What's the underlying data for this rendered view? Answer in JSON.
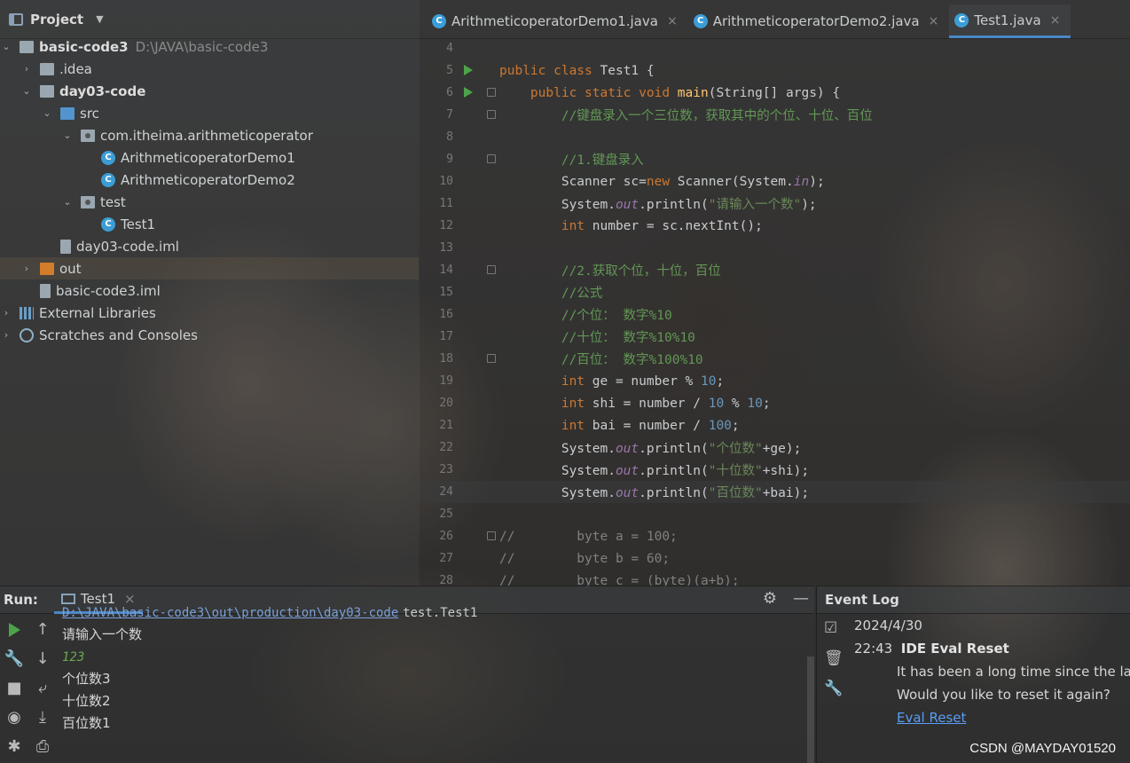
{
  "project": {
    "title": "Project",
    "tree": [
      {
        "label": "basic-code3",
        "extra": "D:\\JAVA\\basic-code3",
        "level": 0,
        "open": true,
        "icon": "module-folder-icon",
        "bold": true
      },
      {
        "label": ".idea",
        "level": 1,
        "open": false,
        "icon": "folder-icon"
      },
      {
        "label": "day03-code",
        "level": 1,
        "open": true,
        "icon": "module-folder-icon",
        "bold": true
      },
      {
        "label": "src",
        "level": 2,
        "open": true,
        "icon": "source-folder-icon"
      },
      {
        "label": "com.itheima.arithmeticoperator",
        "level": 3,
        "open": true,
        "icon": "package-icon"
      },
      {
        "label": "ArithmeticoperatorDemo1",
        "level": 4,
        "icon": "java-class-icon"
      },
      {
        "label": "ArithmeticoperatorDemo2",
        "level": 4,
        "icon": "java-class-icon"
      },
      {
        "label": "test",
        "level": 3,
        "open": true,
        "icon": "package-icon"
      },
      {
        "label": "Test1",
        "level": 4,
        "icon": "java-class-icon"
      },
      {
        "label": "day03-code.iml",
        "level": 2,
        "icon": "iml-file-icon"
      },
      {
        "label": "out",
        "level": 1,
        "open": false,
        "icon": "output-folder-icon",
        "selected": true
      },
      {
        "label": "basic-code3.iml",
        "level": 1,
        "icon": "iml-file-icon"
      },
      {
        "label": "External Libraries",
        "level": 0,
        "open": false,
        "icon": "libraries-icon"
      },
      {
        "label": "Scratches and Consoles",
        "level": 0,
        "open": false,
        "icon": "scratches-icon"
      }
    ]
  },
  "editor": {
    "tabs": [
      {
        "label": "ArithmeticoperatorDemo1.java",
        "active": false
      },
      {
        "label": "ArithmeticoperatorDemo2.java",
        "active": false
      },
      {
        "label": "Test1.java",
        "active": true
      }
    ],
    "lines": [
      {
        "n": "4",
        "html": ""
      },
      {
        "n": "5",
        "run": true,
        "html": "<span class='kw'>public class </span><span class='tx'>Test1 {</span>"
      },
      {
        "n": "6",
        "run": true,
        "fold": true,
        "html": "    <span class='kw'>public static void </span><span class='fn'>main</span><span class='tx'>(String[] args) {</span>"
      },
      {
        "n": "7",
        "fold": true,
        "html": "        <span class='cm'>//键盘录入一个三位数，获取其中的个位、十位、百位</span>"
      },
      {
        "n": "8",
        "html": ""
      },
      {
        "n": "9",
        "fold": true,
        "html": "        <span class='cm'>//1.键盘录入</span>"
      },
      {
        "n": "10",
        "html": "        <span class='tx'>Scanner sc=</span><span class='kw'>new </span><span class='tx'>Scanner(System.</span><span class='it'>in</span><span class='tx'>);</span>"
      },
      {
        "n": "11",
        "html": "        <span class='tx'>System.</span><span class='it'>out</span><span class='tx'>.println(</span><span class='str'>\"请输入一个数\"</span><span class='tx'>);</span>"
      },
      {
        "n": "12",
        "html": "        <span class='kw'>int </span><span class='tx'>number = sc.nextInt();</span>"
      },
      {
        "n": "13",
        "html": ""
      },
      {
        "n": "14",
        "fold": true,
        "html": "        <span class='cm'>//2.获取个位，十位，百位</span>"
      },
      {
        "n": "15",
        "html": "        <span class='cm'>//公式</span>"
      },
      {
        "n": "16",
        "html": "        <span class='cm'>//个位： 数字%10</span>"
      },
      {
        "n": "17",
        "html": "        <span class='cm'>//十位： 数字%10%10</span>"
      },
      {
        "n": "18",
        "fold": true,
        "html": "        <span class='cm'>//百位： 数字%100%10</span>"
      },
      {
        "n": "19",
        "html": "        <span class='kw'>int </span><span class='tx'>ge = number % </span><span class='num'>10</span><span class='tx'>;</span>"
      },
      {
        "n": "20",
        "html": "        <span class='kw'>int </span><span class='tx'>shi = number / </span><span class='num'>10 </span><span class='tx'>% </span><span class='num'>10</span><span class='tx'>;</span>"
      },
      {
        "n": "21",
        "html": "        <span class='kw'>int </span><span class='tx'>bai = number / </span><span class='num'>100</span><span class='tx'>;</span>"
      },
      {
        "n": "22",
        "html": "        <span class='tx'>System.</span><span class='it'>out</span><span class='tx'>.println(</span><span class='str'>\"个位数\"</span><span class='tx'>+ge);</span>"
      },
      {
        "n": "23",
        "html": "        <span class='tx'>System.</span><span class='it'>out</span><span class='tx'>.println(</span><span class='str'>\"十位数\"</span><span class='tx'>+shi);</span>"
      },
      {
        "n": "24",
        "current": true,
        "html": "        <span class='tx'>System.</span><span class='it'>out</span><span class='tx'>.println(</span><span class='str'>\"百位数\"</span><span class='tx'>+bai);</span>"
      },
      {
        "n": "25",
        "html": ""
      },
      {
        "n": "26",
        "fold": true,
        "html": "<span class='cm2'>//        byte a = 100;</span>"
      },
      {
        "n": "27",
        "html": "<span class='cm2'>//        byte b = 60;</span>"
      },
      {
        "n": "28",
        "html": "<span class='cm2'>//        byte c = (byte)(a+b);</span>"
      }
    ]
  },
  "run": {
    "title": "Run:",
    "tab_label": "Test1",
    "command_path": "D:\\JAVA\\basic-code3\\out\\production\\day03-code",
    "command_class": "test.Test1",
    "output": [
      {
        "text": "请输入一个数",
        "kind": "out"
      },
      {
        "text": "123",
        "kind": "input"
      },
      {
        "text": "个位数3",
        "kind": "out"
      },
      {
        "text": "十位数2",
        "kind": "out"
      },
      {
        "text": "百位数1",
        "kind": "out"
      }
    ]
  },
  "eventlog": {
    "title": "Event Log",
    "date": "2024/4/30",
    "time": "22:43",
    "event_title": "IDE Eval Reset",
    "message_1": "It has been a long time since the last",
    "message_2": "Would you like to reset it again?",
    "link": "Eval Reset"
  },
  "watermark": "CSDN @MAYDAY01520"
}
